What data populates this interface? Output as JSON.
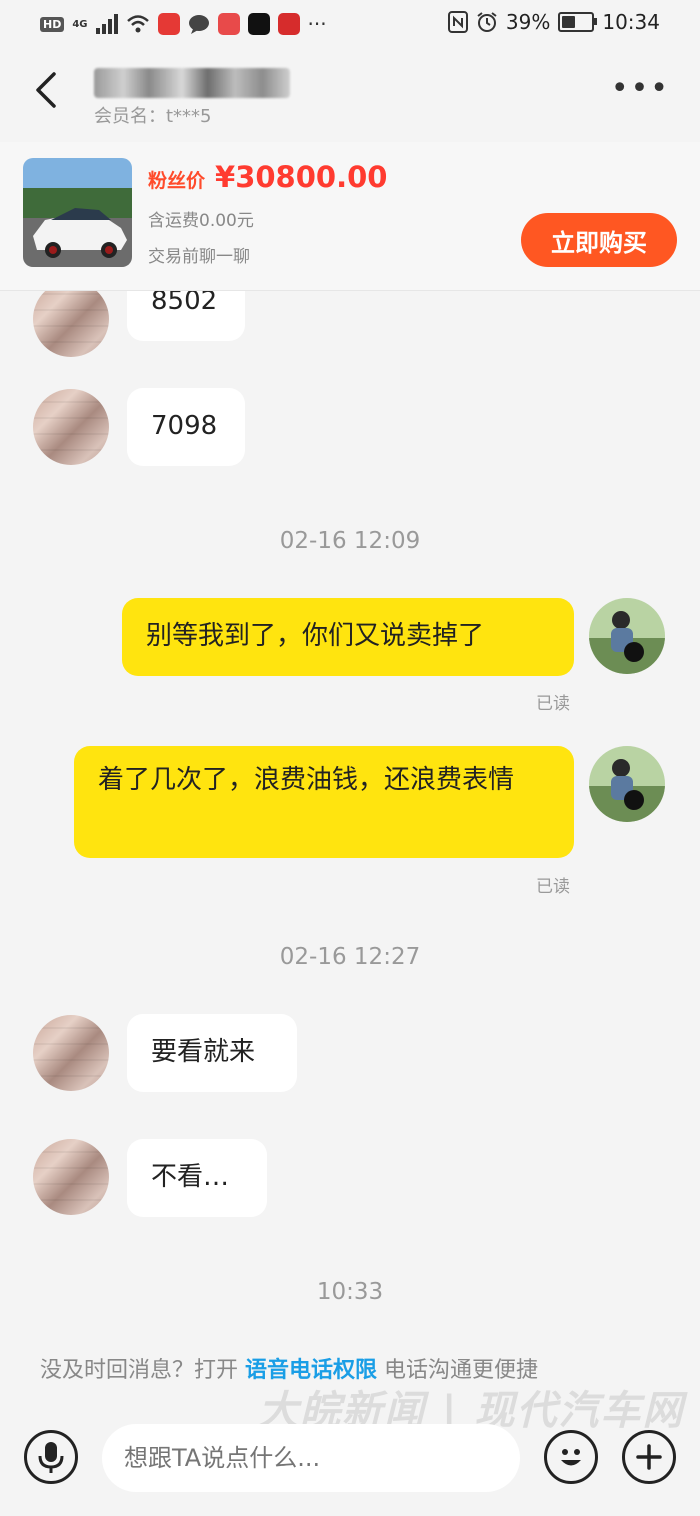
{
  "status_bar": {
    "hd": "HD",
    "network": "4G",
    "battery": "39%",
    "battery_level": 0.39,
    "time": "10:34"
  },
  "header": {
    "member_label": "会员名：t***5",
    "more_icon": "more-icon"
  },
  "product": {
    "price_label": "粉丝价",
    "price": "¥30800.00",
    "shipping": "含运费0.00元",
    "chat_hint": "交易前聊一聊",
    "buy_label": "立即购买"
  },
  "messages": [
    {
      "side": "in",
      "text": "8502"
    },
    {
      "side": "in",
      "text": "7098"
    },
    {
      "type": "time",
      "text": "02-16 12:09"
    },
    {
      "side": "out",
      "text": "别等我到了，你们又说卖掉了",
      "status": "已读"
    },
    {
      "side": "out",
      "text": "着了几次了，浪费油钱，还浪费表情",
      "status": "已读"
    },
    {
      "type": "time",
      "text": "02-16 12:27"
    },
    {
      "side": "in",
      "text": "要看就来"
    },
    {
      "side": "in",
      "text": "不看…"
    },
    {
      "type": "time",
      "text": "10:33"
    }
  ],
  "tip": {
    "prefix": "没及时回消息？打开",
    "link": "语音电话权限",
    "suffix": "电话沟通更便捷"
  },
  "watermark": "大皖新闻 | 现代汽车网",
  "input": {
    "placeholder": "想跟TA说点什么..."
  },
  "colors": {
    "accent": "#ff5722",
    "price": "#ff3b30",
    "out_bubble": "#ffe40f",
    "link": "#1a9ee6"
  }
}
